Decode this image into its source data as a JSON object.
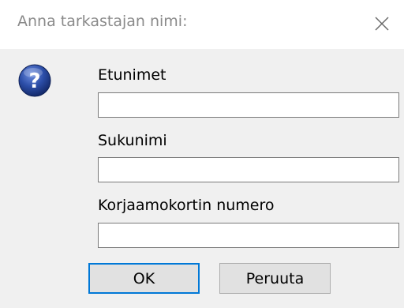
{
  "dialog": {
    "title": "Anna tarkastajan nimi:",
    "close_icon": "close-icon",
    "help_icon": "question-mark-icon"
  },
  "fields": {
    "first_names": {
      "label": "Etunimet",
      "value": ""
    },
    "last_name": {
      "label": "Sukunimi",
      "value": ""
    },
    "card_number": {
      "label": "Korjaamokortin numero",
      "value": ""
    }
  },
  "buttons": {
    "ok_label": "OK",
    "cancel_label": "Peruuta"
  },
  "colors": {
    "accent": "#0078d7",
    "help_icon_blue": "#2a4a9e"
  }
}
